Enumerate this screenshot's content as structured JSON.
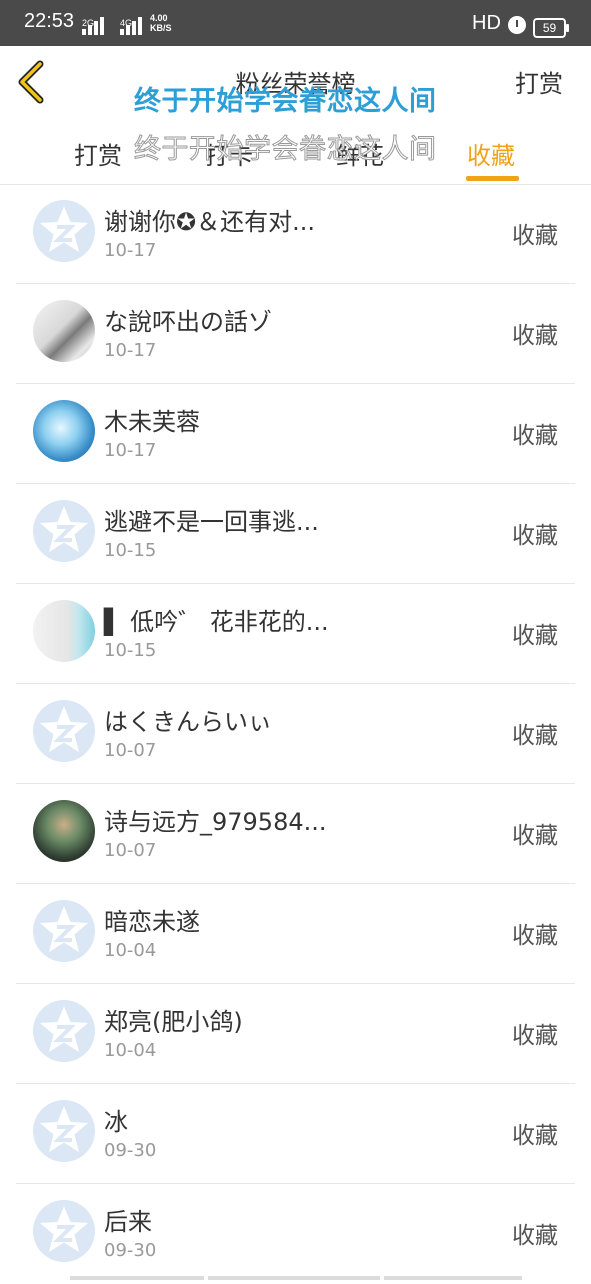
{
  "status_bar": {
    "time": "22:53",
    "sim1_label": "2G",
    "sim2_label": "4G",
    "speed_value": "4.00",
    "speed_unit": "KB/S",
    "hd_label": "HD",
    "battery": "59"
  },
  "header": {
    "title": "粉丝荣誉榜",
    "right_action": "打赏",
    "overlay_text": "终于开始学会眷恋这人间"
  },
  "tabs": {
    "items": [
      {
        "label": "打赏"
      },
      {
        "label": "打卡"
      },
      {
        "label": "鲜花"
      },
      {
        "label": "收藏"
      }
    ],
    "active_index": 3,
    "overlay_text": "终于开始学会眷恋这人间"
  },
  "colors": {
    "accent": "#f0a319",
    "overlay_blue": "#2e9fd6",
    "status_bar": "#4a4a4a"
  },
  "list": {
    "items": [
      {
        "name": "谢谢你✪＆还有对...",
        "date": "10-17",
        "action": "收藏",
        "avatar": "default-avatar-icon"
      },
      {
        "name": "な說吥出の話ゾ",
        "date": "10-17",
        "action": "收藏",
        "avatar": "photo-avatar"
      },
      {
        "name": "木未芙蓉",
        "date": "10-17",
        "action": "收藏",
        "avatar": "photo-avatar"
      },
      {
        "name": "逃避不是一回事逃...",
        "date": "10-15",
        "action": "收藏",
        "avatar": "default-avatar-icon"
      },
      {
        "name": "▌ 低吟゛ 花非花的...",
        "date": "10-15",
        "action": "收藏",
        "avatar": "photo-avatar"
      },
      {
        "name": "はくきんらいぃ",
        "date": "10-07",
        "action": "收藏",
        "avatar": "default-avatar-icon"
      },
      {
        "name": "诗与远方_979584...",
        "date": "10-07",
        "action": "收藏",
        "avatar": "photo-avatar"
      },
      {
        "name": "暗恋未遂",
        "date": "10-04",
        "action": "收藏",
        "avatar": "default-avatar-icon"
      },
      {
        "name": "郑亮(肥小鸽)",
        "date": "10-04",
        "action": "收藏",
        "avatar": "default-avatar-icon"
      },
      {
        "name": "冰",
        "date": "09-30",
        "action": "收藏",
        "avatar": "default-avatar-icon"
      },
      {
        "name": "后来",
        "date": "09-30",
        "action": "收藏",
        "avatar": "default-avatar-icon"
      }
    ]
  }
}
